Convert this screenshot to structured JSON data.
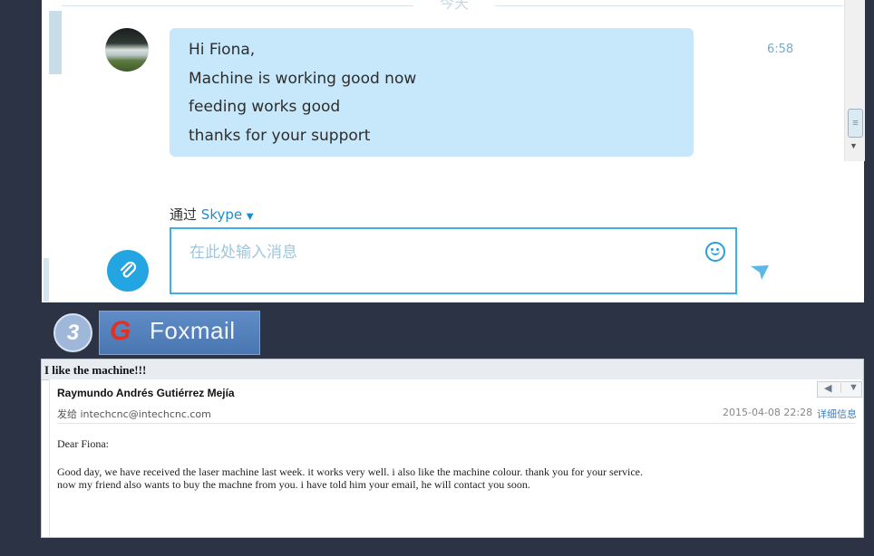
{
  "skype": {
    "day_label": "今天",
    "message_lines": [
      "Hi Fiona,",
      "Machine is working good now",
      "feeding works good",
      "thanks for your support"
    ],
    "time": "6:58",
    "via_prefix": "通过",
    "via_service": "Skype",
    "input_placeholder": "在此处输入消息",
    "colors": {
      "bubble": "#c7e8fa",
      "accent": "#22a5e0"
    }
  },
  "step_badge": "3",
  "foxmail": {
    "logo_text": "Foxmail"
  },
  "email": {
    "subject": "I like the machine!!!",
    "sender": "Raymundo Andrés Gutiérrez Mejía",
    "recipient": "发给 intechcnc@intechcnc.com",
    "date": "2015-04-08 22:28",
    "details_link": "详细信息",
    "greeting": "Dear Fiona:",
    "body_lines": [
      "Good day, we have received the laser machine last week. it works very well. i also like the machine colour. thank you for your service.",
      "now my friend also wants to buy the machne from you. i have told him your email, he will contact you soon."
    ]
  }
}
